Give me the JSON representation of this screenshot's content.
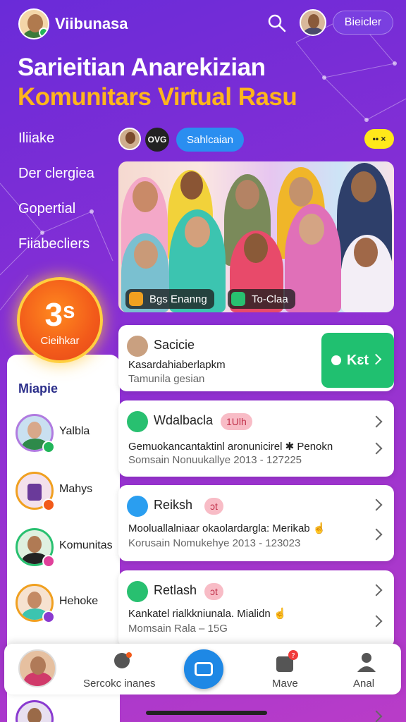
{
  "header": {
    "app_name": "Viibunasa",
    "action_pill": "Bieicler"
  },
  "hero": {
    "headline": "Sarieitian Anarekizian",
    "subheadline": "Komunitars Virtual Rasu"
  },
  "nav_links": [
    "Iliiake",
    "Der clergiea",
    "Gopertial",
    "Fiiabecliers"
  ],
  "chips": {
    "dark": "OVG",
    "blue": "Sahlcaian",
    "yellow": "•• ×"
  },
  "photo": {
    "pill_left": "Bgs Enanng",
    "pill_right": "To-Claa"
  },
  "countdown": {
    "value": "3ˢ",
    "label": "Cieihkar"
  },
  "side_panel": {
    "title": "Miapie",
    "contacts": [
      "Yalbla",
      "Mahys",
      "Komunitas",
      "Hehoke"
    ]
  },
  "cards": [
    {
      "title": "Sacicie",
      "desc": "Kasardahiaberlapkm",
      "meta": "Tamunila gesian"
    },
    {
      "title": "Wdalbacla",
      "tag": "1Ulh",
      "desc": "Gemuokancantaktinl aronunicirel ✱ Penokn",
      "meta": "Somsain Nonuukallye 2013 - 127225"
    },
    {
      "title": "Reiksh",
      "tag": "ɔt",
      "desc": "Mooluallalniaar okaolardargla: Merikab ☝",
      "meta": "Korusain Nomukehye 2013 - 123023"
    },
    {
      "title": "Retlash",
      "tag": "ɔt",
      "desc": "Kankatel rialkkniunala. Mialidn ☝",
      "meta": "Momsain Rala – 15G"
    }
  ],
  "join_button": "Kɛt",
  "bottom_nav": {
    "item1": "Sercokc inanes",
    "item2": "Mave",
    "item3": "Anal"
  },
  "colors": {
    "accent_green": "#20c070",
    "headline_yellow": "#ffb51c",
    "background_purple": "#8a2fd4",
    "primary_blue": "#2a8ef0"
  }
}
